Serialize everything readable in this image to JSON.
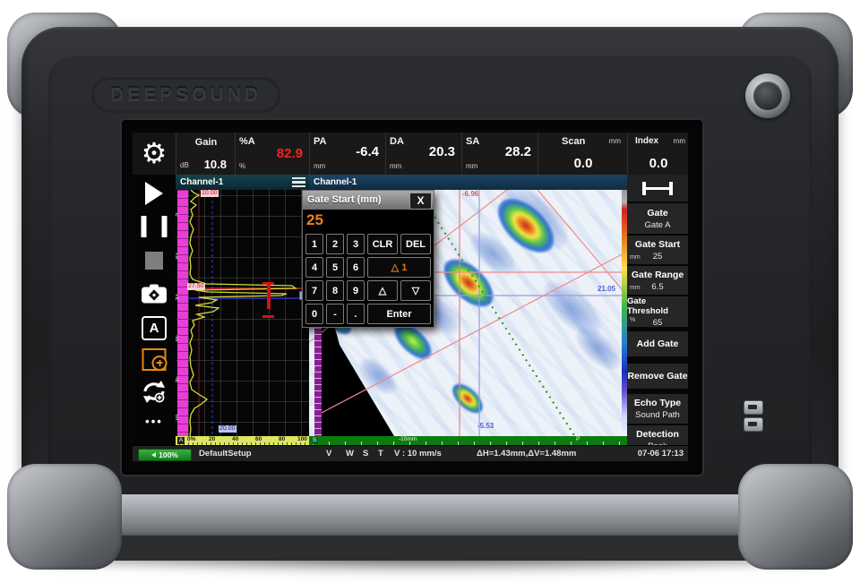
{
  "brand": "DEEPSOUND",
  "icons": {
    "gear": "⚙",
    "more": "•••",
    "annotate": "A"
  },
  "top_bar": {
    "cells": [
      {
        "label": "Gain",
        "unit": "dB",
        "value": "10.8"
      },
      {
        "label": "%A",
        "unit": "%",
        "value": "82.9"
      },
      {
        "label": "PA",
        "unit": "mm",
        "value": "-6.4"
      },
      {
        "label": "DA",
        "unit": "mm",
        "value": "20.3"
      },
      {
        "label": "SA",
        "unit": "mm",
        "value": "28.2"
      },
      {
        "label": "Scan",
        "unit": "mm",
        "value": "0.0"
      },
      {
        "label": "Index",
        "unit": "mm",
        "value": "0.0"
      }
    ]
  },
  "ascan": {
    "title": "Channel-1",
    "marker_top": "10.00",
    "marker_gate": "27.50",
    "marker_bottom": "20.00",
    "axis_prefix": "A",
    "axis_ticks": [
      "0%",
      "20",
      "40",
      "60",
      "80",
      "100"
    ],
    "depth_ticks": [
      "5",
      "10",
      "15",
      "20",
      "25",
      "30"
    ]
  },
  "sscan": {
    "title": "Channel-1",
    "label_top": "-6.96",
    "label_right": "21.05",
    "label_bottom": "-5.53",
    "ruler_prefix": "S",
    "ruler_label": "-10mm",
    "ruler_marker": "P",
    "side_ticks": [
      "20",
      "30",
      "40"
    ]
  },
  "keypad": {
    "title": "Gate Start (mm)",
    "close": "X",
    "value": "25",
    "keys": [
      "1",
      "2",
      "3",
      "CLR",
      "DEL",
      "4",
      "5",
      "6",
      "△ 1",
      "7",
      "8",
      "9",
      "△",
      "▽",
      "0",
      "-",
      ".",
      "Enter"
    ]
  },
  "right_panel": {
    "rows": [
      {
        "label": "Gate",
        "unit": "",
        "value": "Gate A"
      },
      {
        "label": "Gate Start",
        "unit": "mm",
        "value": "25"
      },
      {
        "label": "Gate Range",
        "unit": "mm",
        "value": "6.5"
      },
      {
        "label": "Gate Threshold",
        "unit": "%",
        "value": "65"
      }
    ],
    "buttons": [
      "Add Gate",
      "Remove Gate"
    ],
    "rows2": [
      {
        "label": "Echo Type",
        "value": "Sound Path"
      },
      {
        "label": "Detection",
        "value": "Peak"
      }
    ]
  },
  "status_bar": {
    "battery": "100%",
    "setup": "DefaultSetup",
    "modes": [
      "V",
      "W",
      "S",
      "T"
    ],
    "speed": "V : 10 mm/s",
    "delta": "ΔH=1.43mm,ΔV=1.48mm",
    "datetime": "07-06 17:13"
  }
}
